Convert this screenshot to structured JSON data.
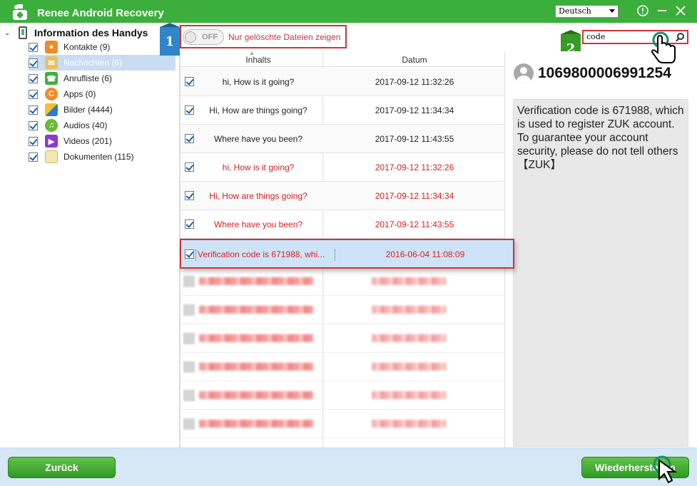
{
  "app": {
    "title": "Renee Android Recovery",
    "language": "Deutsch"
  },
  "sidebar": {
    "root_label": "Information des Handys",
    "items": [
      {
        "label": "Kontakte (9)",
        "icon": "contacts-icon",
        "color": "#f08a2a"
      },
      {
        "label": "Nachrichten (6)",
        "icon": "messages-icon",
        "color": "#e8c060"
      },
      {
        "label": "Anrufliste (6)",
        "icon": "call-log-icon",
        "color": "#3fae3f"
      },
      {
        "label": "Apps (0)",
        "icon": "apps-icon",
        "color": "#f08a2a"
      },
      {
        "label": "Bilder (4444)",
        "icon": "pictures-icon",
        "color": "#2a7ad8"
      },
      {
        "label": "Audios (40)",
        "icon": "audio-icon",
        "color": "#6ab83a"
      },
      {
        "label": "Videos (201)",
        "icon": "videos-icon",
        "color": "#8a3ad0"
      },
      {
        "label": "Dokumenten (115)",
        "icon": "documents-icon",
        "color": "#e8d890"
      }
    ]
  },
  "filter": {
    "toggle_text": "OFF",
    "label": "Nur gelöschte Dateien zeigen"
  },
  "steps": {
    "one": "1",
    "two": "2"
  },
  "search": {
    "value": "code"
  },
  "table": {
    "headers": {
      "content": "Inhalts",
      "date": "Datum"
    },
    "rows": [
      {
        "content": "hi, How is it going?",
        "date": "2017-09-12 11:32:26",
        "deleted": false
      },
      {
        "content": "Hi, How are things going?",
        "date": "2017-09-12 11:34:34",
        "deleted": false
      },
      {
        "content": "Where have you been?",
        "date": "2017-09-12 11:43:55",
        "deleted": false
      },
      {
        "content": "hi, How is it going?",
        "date": "2017-09-12 11:32:26",
        "deleted": true
      },
      {
        "content": "Hi, How are things going?",
        "date": "2017-09-12 11:34:34",
        "deleted": true
      },
      {
        "content": "Where have you been?",
        "date": "2017-09-12 11:43:55",
        "deleted": true
      }
    ],
    "highlighted": {
      "content": "Verification code is 671988, whi...",
      "date": "2016-06-04 11:08:09"
    }
  },
  "detail": {
    "sender": "1069800006991254",
    "message": "Verification code is 671988, which is used to register ZUK account. To guarantee your account security, please do not tell others【ZUK】"
  },
  "footer": {
    "back": "Zurück",
    "recover": "Wiederherstellen"
  },
  "colors": {
    "title_bar": "#3cae3c",
    "highlight_red": "#d0323c",
    "deleted_text": "#d82020"
  }
}
